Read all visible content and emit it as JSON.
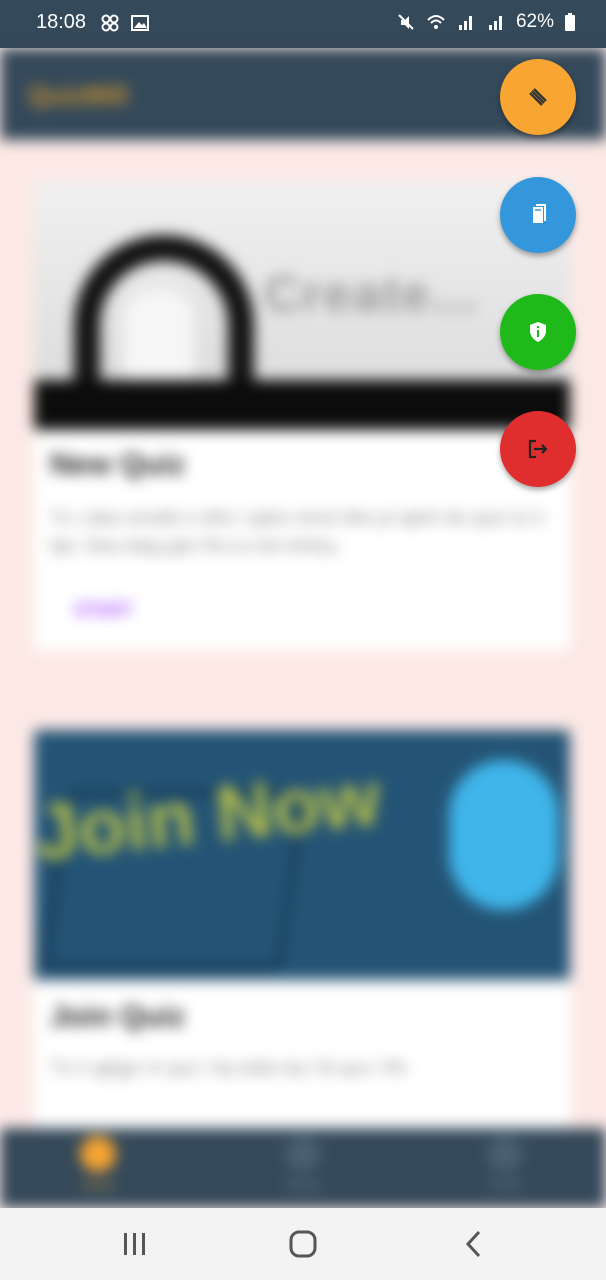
{
  "status_bar": {
    "time": "18:08",
    "battery": "62%",
    "icons": [
      "notification-icon",
      "gallery-icon",
      "mute-icon",
      "wifi-icon",
      "signal-icon",
      "signal-icon",
      "battery-icon"
    ]
  },
  "app": {
    "title": "QuizMill"
  },
  "cards": [
    {
      "image_text": "Create...",
      "title": "New Quiz",
      "description": "Tu i alas smetki e dhe i ajets mirot dhe pi ajetri de quiz tu h tipi. Nea daig pjer fhs tu tuk tmbsy.",
      "button": "START"
    },
    {
      "image_text": "Join Now",
      "title": "Join Quiz",
      "description": "Tu h qjejjyr in quz i tiq stats tej i tb quz i fhl."
    }
  ],
  "fabs": {
    "menu_icon": "menu-icon",
    "book_icon": "book-icon",
    "shield_icon": "shield-icon",
    "logout_icon": "logout-icon"
  },
  "bottom_nav": {
    "items": [
      {
        "label": "Home",
        "icon": "home-icon"
      },
      {
        "label": "History",
        "icon": "history-icon"
      },
      {
        "label": "Profile",
        "icon": "profile-icon"
      }
    ]
  },
  "colors": {
    "primary_dark": "#34495a",
    "accent_orange": "#f8a531",
    "accent_blue": "#3497db",
    "accent_green": "#1fba1a",
    "accent_red": "#df2e2d",
    "background_pink": "#fce9e6"
  }
}
